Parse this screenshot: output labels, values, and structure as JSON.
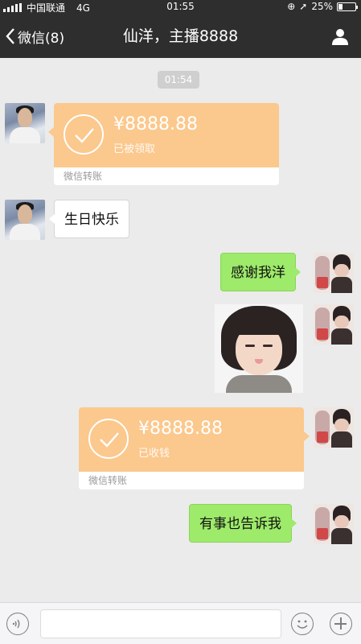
{
  "status_bar": {
    "carrier": "中国联通",
    "network": "4G",
    "time": "01:55",
    "battery": "25%",
    "battery_level": 0.25
  },
  "nav": {
    "back_label": "微信(8)",
    "title": "仙洋，主播8888",
    "user_icon": "person-icon"
  },
  "messages": {
    "timestamp": "01:54",
    "transfer_received": {
      "amount": "¥8888.88",
      "status": "已被领取",
      "footer": "微信转账"
    },
    "text_birthday": "生日快乐",
    "text_thanks": "感谢我洋",
    "sticker_icon": "girl-sticker",
    "transfer_sent": {
      "amount": "¥8888.88",
      "status": "已收钱",
      "footer": "微信转账"
    },
    "text_tellme": "有事也告诉我"
  },
  "input_bar": {
    "voice_icon": "voice-icon",
    "emoji_icon": "emoji-icon",
    "plus_icon": "plus-icon"
  },
  "colors": {
    "header_bg": "#2e2e2e",
    "chat_bg": "#ebebeb",
    "transfer_bg": "#fbc88d",
    "sent_bubble": "#9eea6a"
  }
}
